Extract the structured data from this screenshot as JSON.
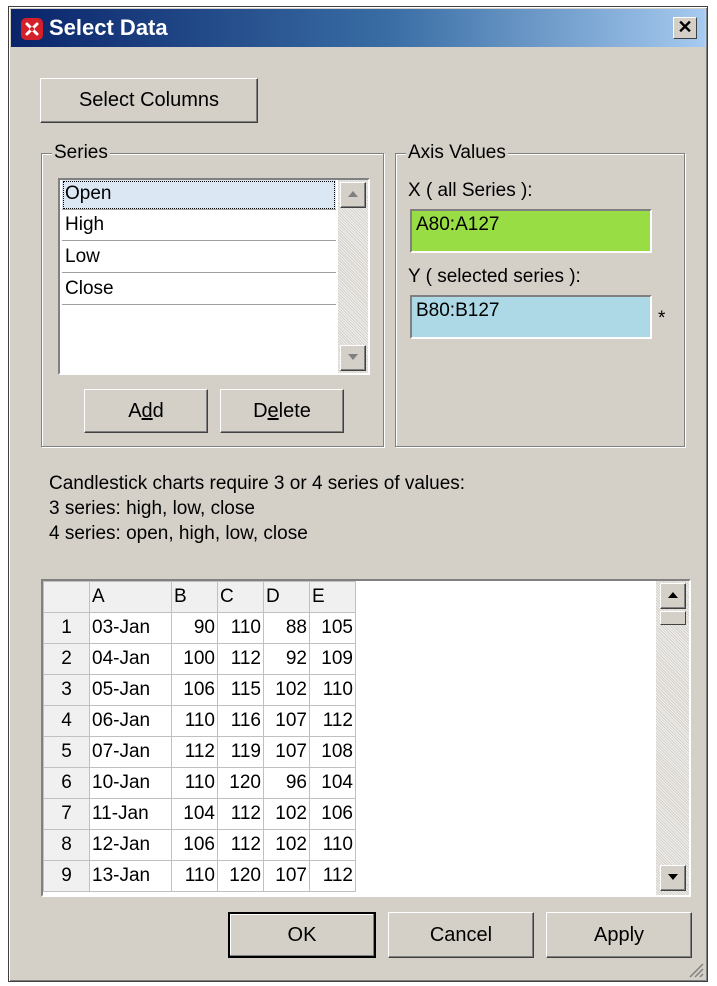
{
  "window": {
    "title": "Select Data",
    "close_glyph": "✕"
  },
  "buttons": {
    "select_columns": "Select Columns",
    "add": "Add",
    "delete": "Delete",
    "ok": "OK",
    "cancel": "Cancel",
    "apply": "Apply"
  },
  "series": {
    "legend": "Series",
    "items": [
      "Open",
      "High",
      "Low",
      "Close"
    ],
    "selected": "Open"
  },
  "axis": {
    "legend": "Axis Values",
    "x_label": "X ( all Series ):",
    "x_value": "A80:A127",
    "x_color": "#99dd44",
    "y_label": "Y ( selected series ):",
    "y_value": "B80:B127",
    "y_color": "#add8e6",
    "y_marker": "*"
  },
  "info": [
    "Candlestick charts require 3 or 4 series of values:",
    "3 series: high, low, close",
    "4 series: open, high, low, close"
  ],
  "grid": {
    "columns": [
      "A",
      "B",
      "C",
      "D",
      "E"
    ],
    "rows": [
      [
        "1",
        "03-Jan",
        "90",
        "110",
        "88",
        "105"
      ],
      [
        "2",
        "04-Jan",
        "100",
        "112",
        "92",
        "109"
      ],
      [
        "3",
        "05-Jan",
        "106",
        "115",
        "102",
        "110"
      ],
      [
        "4",
        "06-Jan",
        "110",
        "116",
        "107",
        "112"
      ],
      [
        "5",
        "07-Jan",
        "112",
        "119",
        "107",
        "108"
      ],
      [
        "6",
        "10-Jan",
        "110",
        "120",
        "96",
        "104"
      ],
      [
        "7",
        "11-Jan",
        "104",
        "112",
        "102",
        "106"
      ],
      [
        "8",
        "12-Jan",
        "106",
        "112",
        "102",
        "110"
      ],
      [
        "9",
        "13-Jan",
        "110",
        "120",
        "107",
        "112"
      ]
    ]
  }
}
